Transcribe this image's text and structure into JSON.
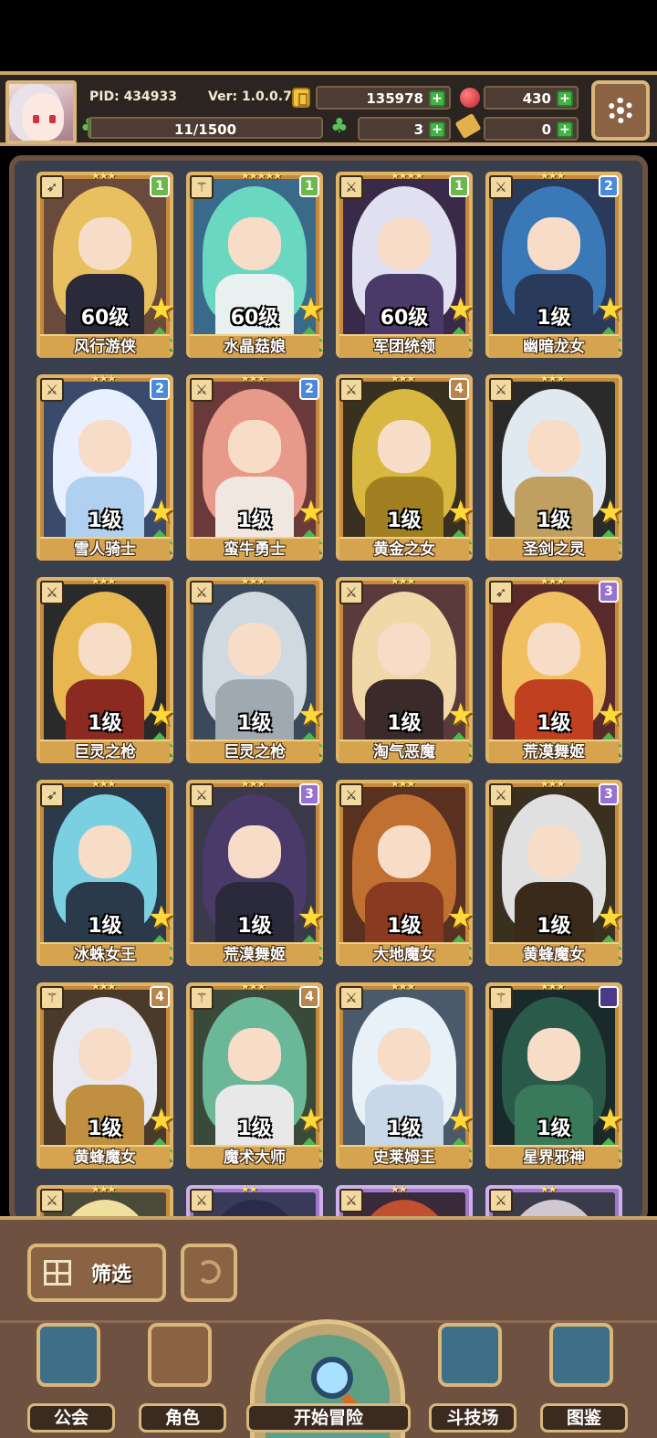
{
  "hud": {
    "pid": "PID: 434933",
    "version": "Ver: 1.0.0.7",
    "gold": "135978",
    "ruby": "430",
    "exp": "11/1500",
    "exp_fraction": 0.0073,
    "clover": "3",
    "ticket": "0"
  },
  "characters": [
    {
      "name": "风行游侠",
      "level": "60级",
      "stars": "★★★",
      "badge": "1",
      "badge_color": "green",
      "type_icon": "bow-icon",
      "hair": "#e8c060",
      "outfit": "#2a2a3a",
      "bg": "#6a4a3a"
    },
    {
      "name": "水晶菇娘",
      "level": "60级",
      "stars": "★★★★★",
      "badge": "1",
      "badge_color": "green",
      "type_icon": "wand-icon",
      "hair": "#6ad8c0",
      "outfit": "#e8f0f0",
      "bg": "#3a6a8a"
    },
    {
      "name": "军团统领",
      "level": "60级",
      "stars": "★★★★",
      "badge": "1",
      "badge_color": "green",
      "type_icon": "sword-icon",
      "hair": "#e0e0f0",
      "outfit": "#4a3a6a",
      "bg": "#3a2a4a"
    },
    {
      "name": "幽暗龙女",
      "level": "1级",
      "stars": "★★★",
      "badge": "2",
      "badge_color": "blue",
      "type_icon": "sword-icon",
      "hair": "#3a78b8",
      "outfit": "#2a3a5a",
      "bg": "#2a3a5a"
    },
    {
      "name": "雪人骑士",
      "level": "1级",
      "stars": "★★★",
      "badge": "2",
      "badge_color": "blue",
      "type_icon": "sword-icon",
      "hair": "#e8f0ff",
      "outfit": "#b0d0f0",
      "bg": "#3a4a6a"
    },
    {
      "name": "蛮牛勇士",
      "level": "1级",
      "stars": "★★★",
      "badge": "2",
      "badge_color": "blue",
      "type_icon": "sword-icon",
      "hair": "#e89a8a",
      "outfit": "#f0e8e0",
      "bg": "#6a3a3a"
    },
    {
      "name": "黄金之女",
      "level": "1级",
      "stars": "★★★",
      "badge": "4",
      "badge_color": "orange",
      "type_icon": "sword-icon",
      "hair": "#d8b840",
      "outfit": "#a08020",
      "bg": "#3a3020"
    },
    {
      "name": "圣剑之灵",
      "level": "1级",
      "stars": "★★★",
      "badge": "",
      "badge_color": "",
      "type_icon": "sword-icon",
      "hair": "#e0e8f0",
      "outfit": "#c0a060",
      "bg": "#2a2a2a"
    },
    {
      "name": "巨灵之枪",
      "level": "1级",
      "stars": "★★★",
      "badge": "",
      "badge_color": "",
      "type_icon": "sword-icon",
      "hair": "#e8b850",
      "outfit": "#8a2a20",
      "bg": "#2a2a2a"
    },
    {
      "name": "巨灵之枪",
      "level": "1级",
      "stars": "★★★",
      "badge": "",
      "badge_color": "",
      "type_icon": "sword-icon",
      "hair": "#d0d8e0",
      "outfit": "#a0a8b0",
      "bg": "#3a4a5a"
    },
    {
      "name": "淘气恶魔",
      "level": "1级",
      "stars": "★★★",
      "badge": "",
      "badge_color": "",
      "type_icon": "sword-icon",
      "hair": "#f0d8a8",
      "outfit": "#3a2a2a",
      "bg": "#5a3a3a"
    },
    {
      "name": "荒漠舞姬",
      "level": "1级",
      "stars": "★★★",
      "badge": "3",
      "badge_color": "purple",
      "type_icon": "bow-icon",
      "hair": "#f0c060",
      "outfit": "#c04020",
      "bg": "#5a2a2a"
    },
    {
      "name": "冰蛛女王",
      "level": "1级",
      "stars": "★★★",
      "badge": "",
      "badge_color": "",
      "type_icon": "bow-icon",
      "hair": "#7ad0e0",
      "outfit": "#2a3a4a",
      "bg": "#2a3a4a"
    },
    {
      "name": "荒漠舞姬",
      "level": "1级",
      "stars": "★★★",
      "badge": "3",
      "badge_color": "purple",
      "type_icon": "sword-icon",
      "hair": "#4a3a6a",
      "outfit": "#2a2a3a",
      "bg": "#3a3a4a"
    },
    {
      "name": "大地魔女",
      "level": "1级",
      "stars": "★★★",
      "badge": "",
      "badge_color": "",
      "type_icon": "sword-icon",
      "hair": "#c07030",
      "outfit": "#8a3a20",
      "bg": "#5a3020"
    },
    {
      "name": "黄蜂魔女",
      "level": "1级",
      "stars": "★★★",
      "badge": "3",
      "badge_color": "purple",
      "type_icon": "sword-icon",
      "hair": "#e0e0e0",
      "outfit": "#3a2a1a",
      "bg": "#3a3020"
    },
    {
      "name": "黄蜂魔女",
      "level": "1级",
      "stars": "★★★",
      "badge": "4",
      "badge_color": "orange",
      "type_icon": "wand-icon",
      "hair": "#e8e8f0",
      "outfit": "#c09040",
      "bg": "#4a3a2a"
    },
    {
      "name": "魔术大师",
      "level": "1级",
      "stars": "★★★",
      "badge": "4",
      "badge_color": "orange",
      "type_icon": "wand-icon",
      "hair": "#6ab898",
      "outfit": "#e8e8e8",
      "bg": "#3a4a3a"
    },
    {
      "name": "史莱姆王",
      "level": "1级",
      "stars": "★★★",
      "badge": "",
      "badge_color": "",
      "type_icon": "sword-icon",
      "hair": "#e8f0f8",
      "outfit": "#c8d8e8",
      "bg": "#4a5a6a"
    },
    {
      "name": "星界邪神",
      "level": "1级",
      "stars": "★★★",
      "badge": "",
      "badge_color": "dark",
      "type_icon": "wand-icon",
      "hair": "#2a5a4a",
      "outfit": "#3a7a5a",
      "bg": "#1a2a2a"
    },
    {
      "name": "",
      "level": "",
      "stars": "★★★",
      "badge": "",
      "badge_color": "",
      "type_icon": "sword-icon",
      "hair": "#f0e0a0",
      "outfit": "#e0c080",
      "bg": "#4a4a3a",
      "card": "gold"
    },
    {
      "name": "",
      "level": "",
      "stars": "★★",
      "badge": "",
      "badge_color": "",
      "type_icon": "sword-icon",
      "hair": "#2a2a4a",
      "outfit": "#2a2a3a",
      "bg": "#3a3a5a",
      "card": "purple"
    },
    {
      "name": "",
      "level": "",
      "stars": "★★",
      "badge": "",
      "badge_color": "",
      "type_icon": "sword-icon",
      "hair": "#c05030",
      "outfit": "#5a2a2a",
      "bg": "#3a2a3a",
      "card": "purple"
    },
    {
      "name": "",
      "level": "",
      "stars": "★★",
      "badge": "",
      "badge_color": "",
      "type_icon": "sword-icon",
      "hair": "#d0c8d0",
      "outfit": "#3a3a4a",
      "bg": "#3a3a4a",
      "card": "purple"
    }
  ],
  "controls": {
    "filter_label": "筛选"
  },
  "nav": {
    "guild": "公会",
    "character": "角色",
    "adventure": "开始冒险",
    "arena": "斗技场",
    "codex": "图鉴"
  }
}
